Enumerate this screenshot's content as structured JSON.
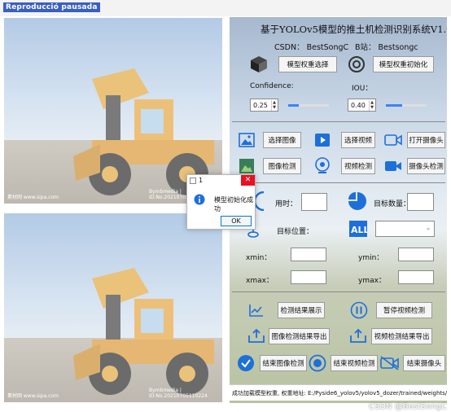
{
  "window": {
    "title": "Reproducció pausada"
  },
  "app": {
    "title": "基于YOLOv5模型的推土机检测识别系统V1.0",
    "csdn": "CSDN：  BestSongC",
    "bilibili": "B站：  Bestsongc"
  },
  "model": {
    "select_label": "模型权重选择",
    "init_label": "模型权重初始化",
    "confidence_label": "Confidence:",
    "confidence_value": "0.25",
    "confidence_fraction": 0.25,
    "iou_label": "IOU：",
    "iou_value": "0.40",
    "iou_fraction": 0.4
  },
  "media": {
    "select_image": "选择图像",
    "select_video": "选择视频",
    "open_camera": "打开摄像头",
    "detect_image": "图像检测",
    "detect_video": "视频检测",
    "detect_camera": "摄像头检测"
  },
  "results": {
    "time_label": "用时：",
    "count_label": "目标数量：",
    "position_label": "目标位置：",
    "xmin_label": "xmin：",
    "ymin_label": "ymin：",
    "xmax_label": "xmax：",
    "ymax_label": "ymax："
  },
  "actions": {
    "show_results": "检测结果展示",
    "pause_video": "暂停视频检测",
    "export_image": "图像检测结果导出",
    "export_video": "视频检测结果导出",
    "end_image": "结束图像检测",
    "end_video": "结束视频检测",
    "end_camera": "结束摄像头"
  },
  "dialog": {
    "title": "1",
    "message": "模型初始化成功",
    "ok": "OK"
  },
  "images": {
    "caption_left": "素材网 www.sipa.com",
    "caption_right": "Bymbmedia  |  ID:No.20210705110224"
  },
  "status": {
    "text": "成功加载模型权重, 权重地址: E:/Pyside6_yolov5/yolov5_dozer/trained/weights/best.pt"
  },
  "watermark": "CSDN @BestSongC",
  "colors": {
    "accent": "#1a73e8",
    "blue_icon": "#1e6fd9"
  }
}
